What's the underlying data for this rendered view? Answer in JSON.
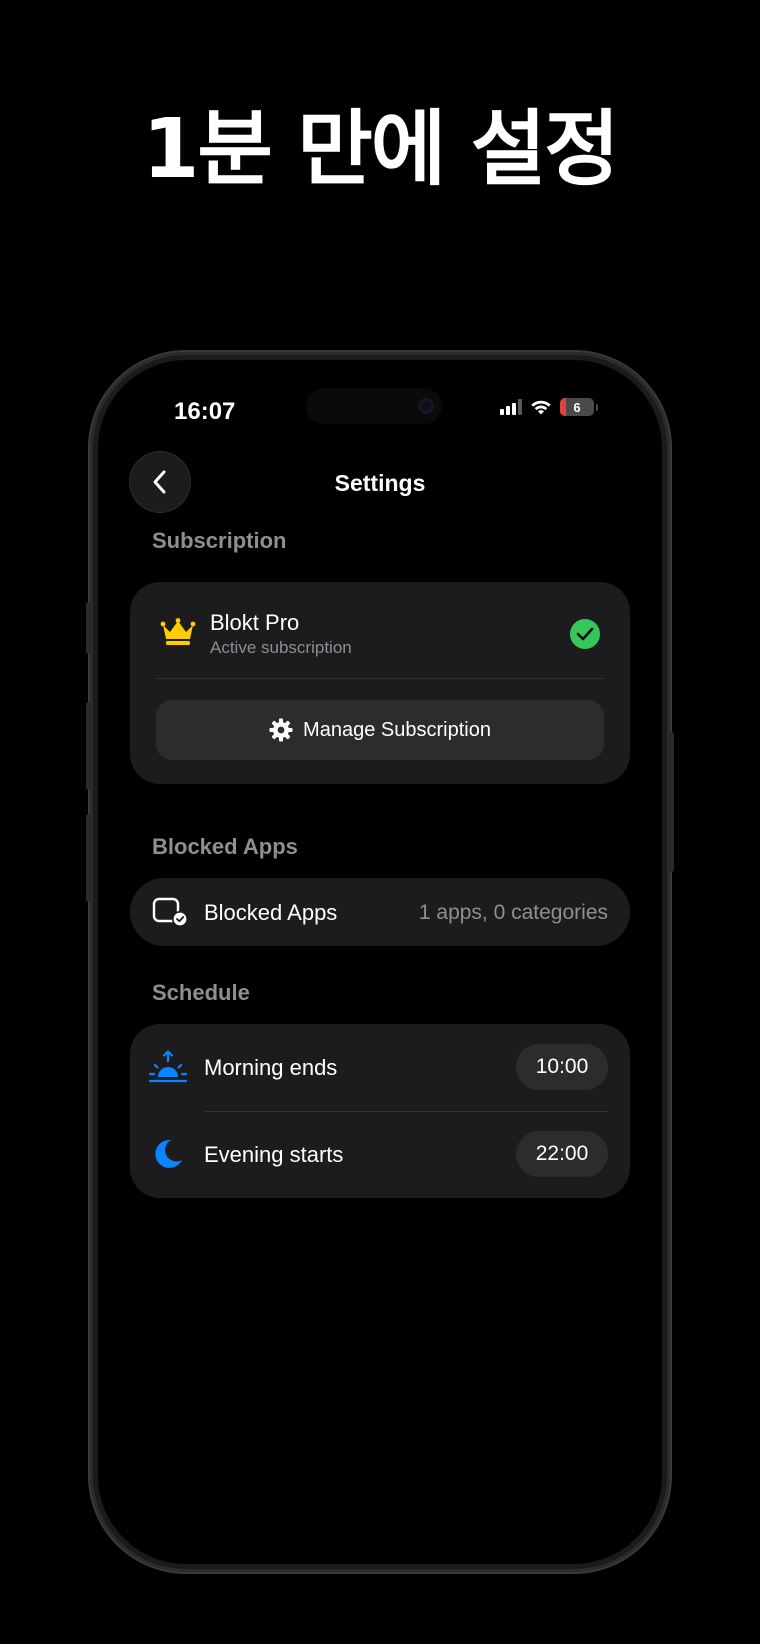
{
  "headline": "1분 만에 설정",
  "status_bar": {
    "time": "16:07",
    "battery_level": "6"
  },
  "nav": {
    "title": "Settings"
  },
  "subscription": {
    "header": "Subscription",
    "title": "Blokt Pro",
    "subtitle": "Active subscription",
    "manage_label": "Manage Subscription"
  },
  "blocked_apps": {
    "header": "Blocked Apps",
    "row_label": "Blocked Apps",
    "row_value": "1 apps, 0 categories"
  },
  "schedule": {
    "header": "Schedule",
    "morning_label": "Morning ends",
    "morning_time": "10:00",
    "evening_label": "Evening starts",
    "evening_time": "22:00"
  },
  "colors": {
    "background": "#000000",
    "card": "#1c1c1e",
    "accent_green": "#34c759",
    "accent_blue": "#0a84ff",
    "crown_gold": "#ffcc00",
    "secondary_text": "#8e8e93"
  }
}
